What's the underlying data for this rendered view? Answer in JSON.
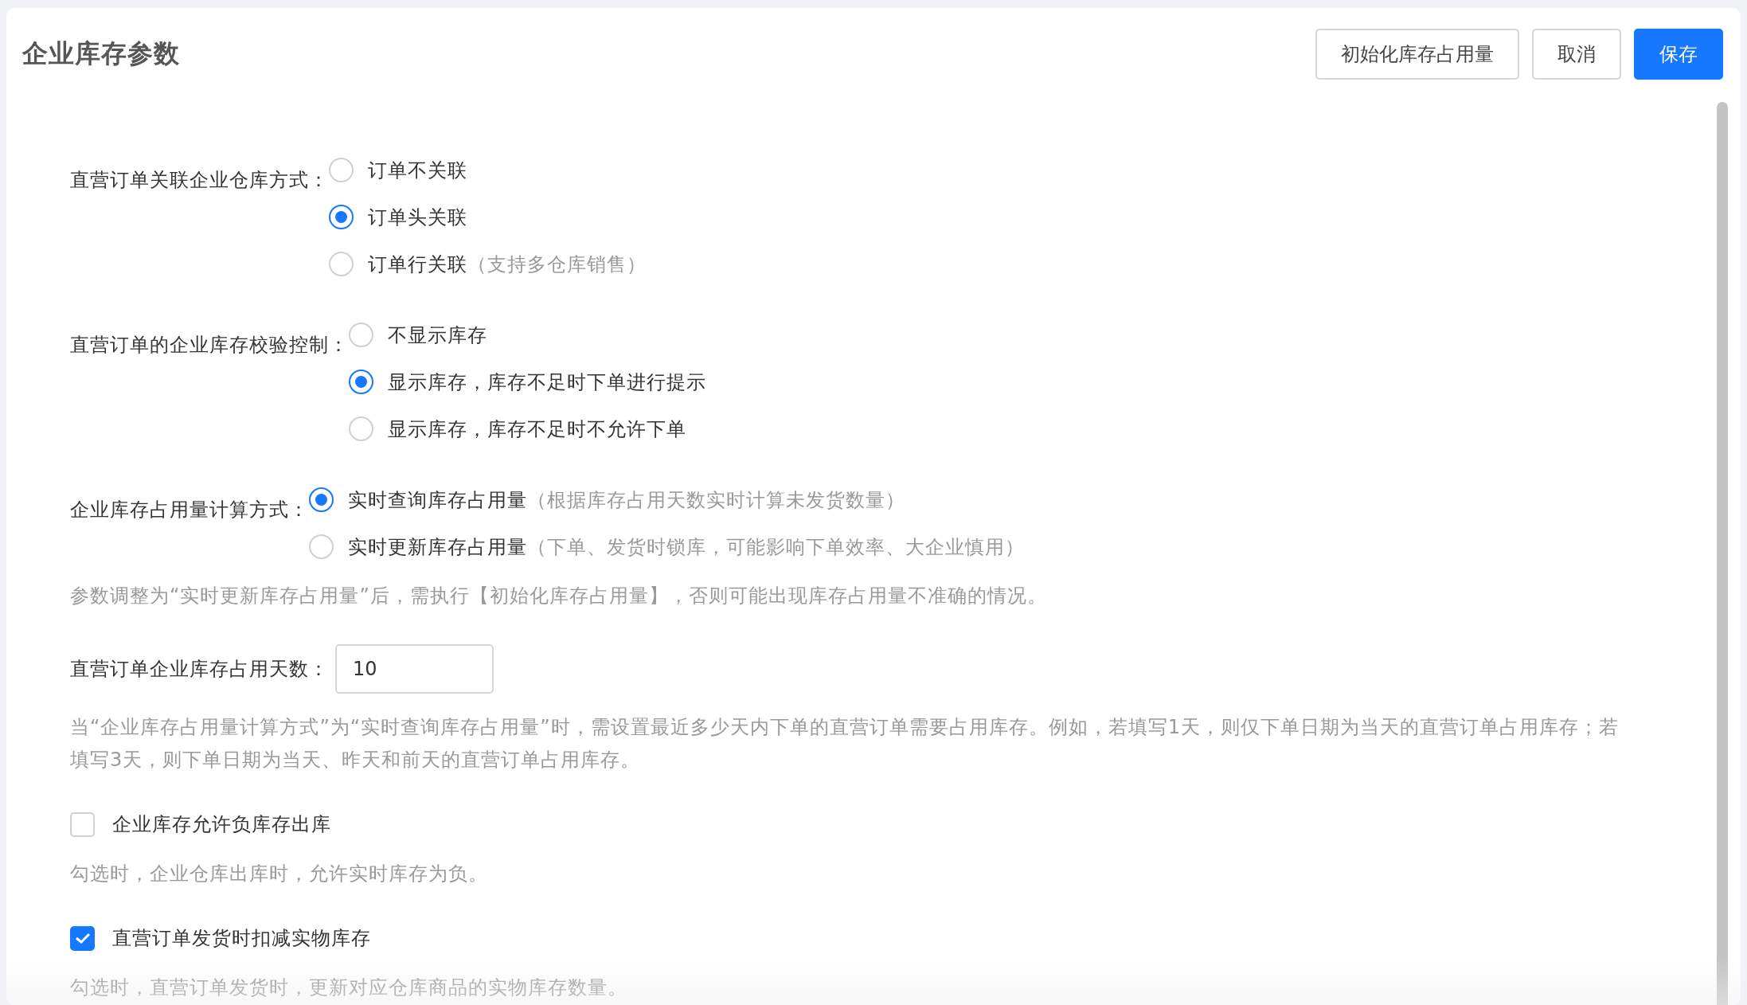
{
  "title": "企业库存参数",
  "actions": [
    {
      "label": "初始化库存占用量",
      "kind": "default"
    },
    {
      "label": "取消",
      "kind": "default"
    },
    {
      "label": "保存",
      "kind": "primary"
    }
  ],
  "sections": [
    {
      "kind": "radio",
      "label": "直营订单关联企业仓库方式：",
      "options": [
        {
          "label": "订单不关联",
          "selected": false
        },
        {
          "label": "订单头关联",
          "selected": true
        },
        {
          "label": "订单行关联",
          "note": "（支持多仓库销售）",
          "selected": false
        }
      ]
    },
    {
      "kind": "radio",
      "label": "直营订单的企业库存校验控制：",
      "options": [
        {
          "label": "不显示库存",
          "selected": false
        },
        {
          "label": "显示库存，库存不足时下单进行提示",
          "selected": true
        },
        {
          "label": "显示库存，库存不足时不允许下单",
          "selected": false
        }
      ]
    },
    {
      "kind": "radio",
      "label": "企业库存占用量计算方式：",
      "options": [
        {
          "label": "实时查询库存占用量",
          "note": "（根据库存占用天数实时计算未发货数量）",
          "selected": true
        },
        {
          "label": "实时更新库存占用量",
          "note": "（下单、发货时锁库，可能影响下单效率、大企业慎用）",
          "selected": false
        }
      ]
    },
    {
      "kind": "note",
      "text": "参数调整为“实时更新库存占用量”后，需执行【初始化库存占用量】，否则可能出现库存占用量不准确的情况。"
    },
    {
      "kind": "input",
      "label": "直营订单企业库存占用天数：",
      "value": "10"
    },
    {
      "kind": "note",
      "text": "当“企业库存占用量计算方式”为“实时查询库存占用量”时，需设置最近多少天内下单的直营订单需要占用库存。例如，若填写1天，则仅下单日期为当天的直营订单占用库存；若填写3天，则下单日期为当天、昨天和前天的直营订单占用库存。"
    },
    {
      "kind": "checkbox",
      "label": "企业库存允许负库存出库",
      "checked": false
    },
    {
      "kind": "note",
      "text": "勾选时，企业仓库出库时，允许实时库存为负。"
    },
    {
      "kind": "checkbox",
      "label": "直营订单发货时扣减实物库存",
      "checked": true
    },
    {
      "kind": "note",
      "text": "勾选时，直营订单发货时，更新对应仓库商品的实物库存数量。"
    }
  ]
}
